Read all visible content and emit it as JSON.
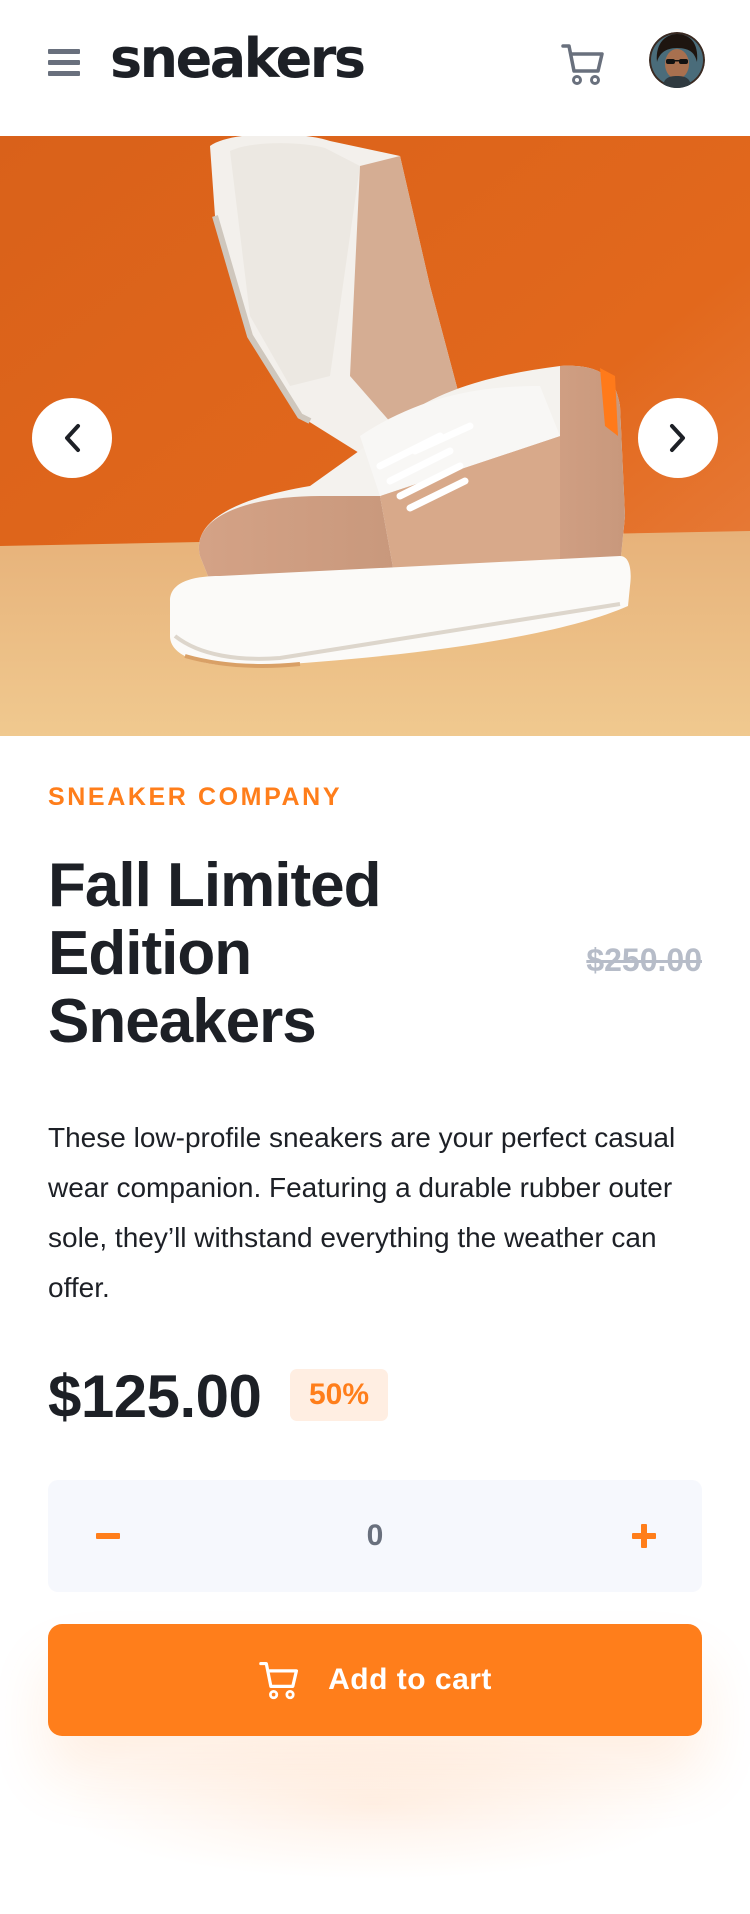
{
  "header": {
    "logo": "sneakers",
    "menu_icon": "hamburger-menu-icon",
    "cart_icon": "cart-icon",
    "avatar_alt": "user-avatar"
  },
  "gallery": {
    "prev_icon": "chevron-left-icon",
    "next_icon": "chevron-right-icon"
  },
  "product": {
    "company": "SNEAKER COMPANY",
    "title": "Fall Limited Edition Sneakers",
    "description": "These low-profile sneakers are your perfect casual wear companion. Featuring a durable rubber outer sole, they’ll withstand everything the weather can offer.",
    "price": "$125.00",
    "discount": "50%",
    "original_price": "$250.00"
  },
  "quantity": {
    "value": "0",
    "minus_icon": "minus-icon",
    "plus_icon": "plus-icon"
  },
  "add_to_cart": {
    "label": "Add to cart",
    "icon": "cart-icon"
  },
  "colors": {
    "accent": "#ff7e1b",
    "accent_pale": "#ffeee2",
    "dark": "#1d2026",
    "grey": "#69707d",
    "light_grey": "#b6bcc8",
    "qty_bg": "#f6f8fd"
  }
}
